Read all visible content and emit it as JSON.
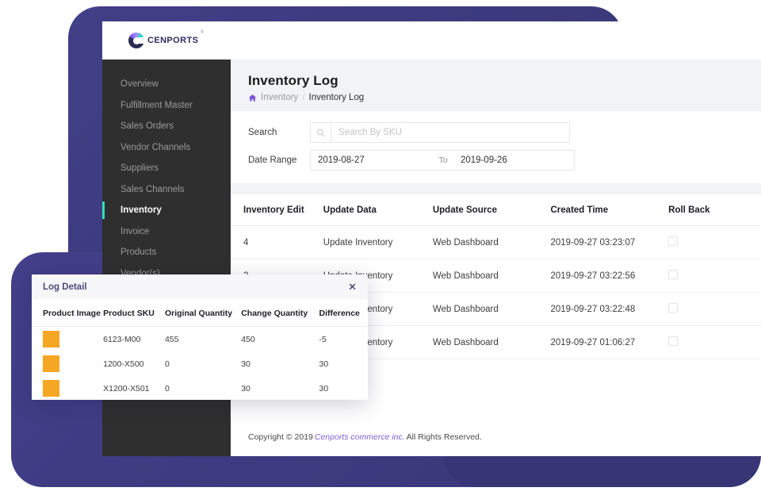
{
  "brand": {
    "name": "CENPORTS",
    "trademark": "®",
    "logo_icon": "cenports-circle-logo"
  },
  "sidebar": {
    "items": [
      {
        "label": "Overview",
        "active": false
      },
      {
        "label": "Fulfillment Master",
        "active": false
      },
      {
        "label": "Sales Orders",
        "active": false
      },
      {
        "label": "Vendor Channels",
        "active": false
      },
      {
        "label": "Suppliers",
        "active": false
      },
      {
        "label": "Sales Channels",
        "active": false
      },
      {
        "label": "Inventory",
        "active": true
      },
      {
        "label": "Invoice",
        "active": false
      },
      {
        "label": "Products",
        "active": false
      },
      {
        "label": "Vendor(s)",
        "active": false
      }
    ]
  },
  "page": {
    "title": "Inventory Log",
    "breadcrumb": {
      "home_icon": "home-icon",
      "parent": "Inventory",
      "separator": "/",
      "current": "Inventory Log"
    }
  },
  "filters": {
    "search": {
      "label": "Search",
      "icon": "search-icon",
      "value": "",
      "placeholder": "Search By SKU"
    },
    "date_range": {
      "label": "Date Range",
      "from": "2019-08-27",
      "to_label": "To",
      "to": "2019-09-26"
    }
  },
  "table": {
    "columns": [
      "Inventory Edit",
      "Update Data",
      "Update Source",
      "Created Time",
      "Roll Back"
    ],
    "rows": [
      {
        "inventory_edit": "4",
        "update_data": "Update Inventory",
        "update_source": "Web Dashboard",
        "created_time": "2019-09-27 03:23:07",
        "roll_back": false
      },
      {
        "inventory_edit": "3",
        "update_data": "Update Inventory",
        "update_source": "Web Dashboard",
        "created_time": "2019-09-27 03:22:56",
        "roll_back": false
      },
      {
        "inventory_edit": "",
        "update_data": "Update Inventory",
        "update_source": "Web Dashboard",
        "created_time": "2019-09-27 03:22:48",
        "roll_back": false
      },
      {
        "inventory_edit": "",
        "update_data": "Update Inventory",
        "update_source": "Web Dashboard",
        "created_time": "2019-09-27 01:06:27",
        "roll_back": false
      }
    ]
  },
  "modal": {
    "title": "Log Detail",
    "close_icon": "close-icon",
    "columns": [
      "Product Image",
      "Product SKU",
      "Original Quantity",
      "Change Quantity",
      "Difference"
    ],
    "rows": [
      {
        "image": "product-thumbnail",
        "sku": "6123-M00",
        "original_quantity": "455",
        "change_quantity": "450",
        "difference": "-5",
        "difference_sign": "negative"
      },
      {
        "image": "product-thumbnail",
        "sku": "1200-X500",
        "original_quantity": "0",
        "change_quantity": "30",
        "difference": "30",
        "difference_sign": "positive"
      },
      {
        "image": "product-thumbnail",
        "sku": "X1200-X501",
        "original_quantity": "0",
        "change_quantity": "30",
        "difference": "30",
        "difference_sign": "positive"
      }
    ]
  },
  "footer": {
    "prefix": "Copyright © 2019",
    "link": "Cenports commerce inc.",
    "suffix": "All Rights Reserved."
  },
  "colors": {
    "accent_teal": "#2fdfb0",
    "accent_purple": "#7b61d8",
    "sidebar_bg": "#2f2f2f",
    "page_bg": "#f2f3f7",
    "deco_indigo": "#3b3a7e",
    "thumb_orange": "#f5a623",
    "diff_positive": "#2fcfa5",
    "diff_negative": "#f0a32a"
  }
}
